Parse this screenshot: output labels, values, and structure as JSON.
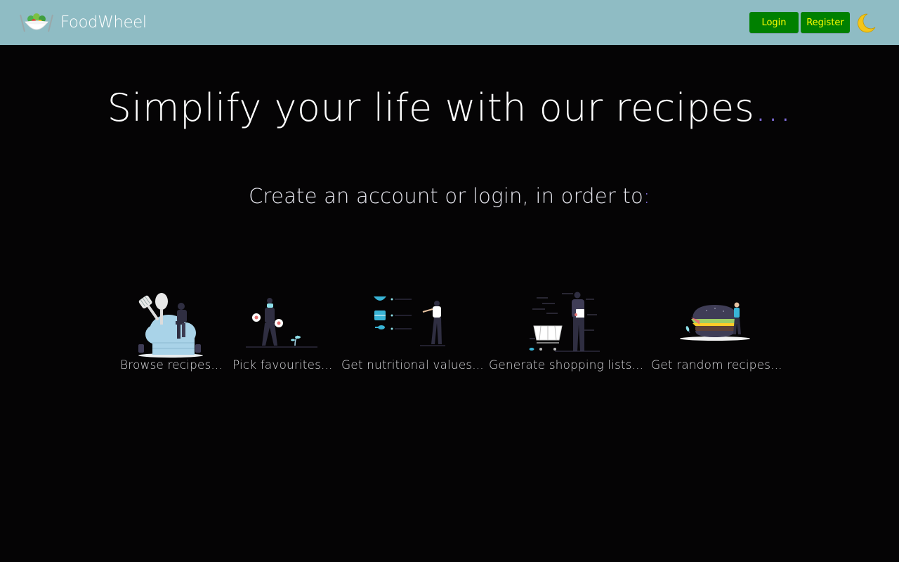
{
  "header": {
    "brand": "FoodWheel",
    "login_label": "Login",
    "register_label": "Register",
    "icons": {
      "logo": "salad-bowl-logo-icon",
      "theme_toggle": "moon-icon"
    }
  },
  "hero": {
    "title": "Simplify your life with our recipes",
    "title_suffix": "...",
    "subtitle": "Create an account or login, in order to",
    "subtitle_suffix": ":"
  },
  "features": [
    {
      "label": "Browse recipes...",
      "icon": "chef-hat-illustration"
    },
    {
      "label": "Pick favourites...",
      "icon": "person-picking-illustration"
    },
    {
      "label": "Get nutritional values...",
      "icon": "nutrition-illustration"
    },
    {
      "label": "Generate shopping lists...",
      "icon": "shopping-cart-illustration"
    },
    {
      "label": "Get random recipes...",
      "icon": "burger-illustration"
    }
  ],
  "colors": {
    "navbar": "#8fbcc4",
    "button_bg": "#008000",
    "button_text": "#ffff00",
    "accent": "#7e6bd6",
    "background": "#050405"
  }
}
